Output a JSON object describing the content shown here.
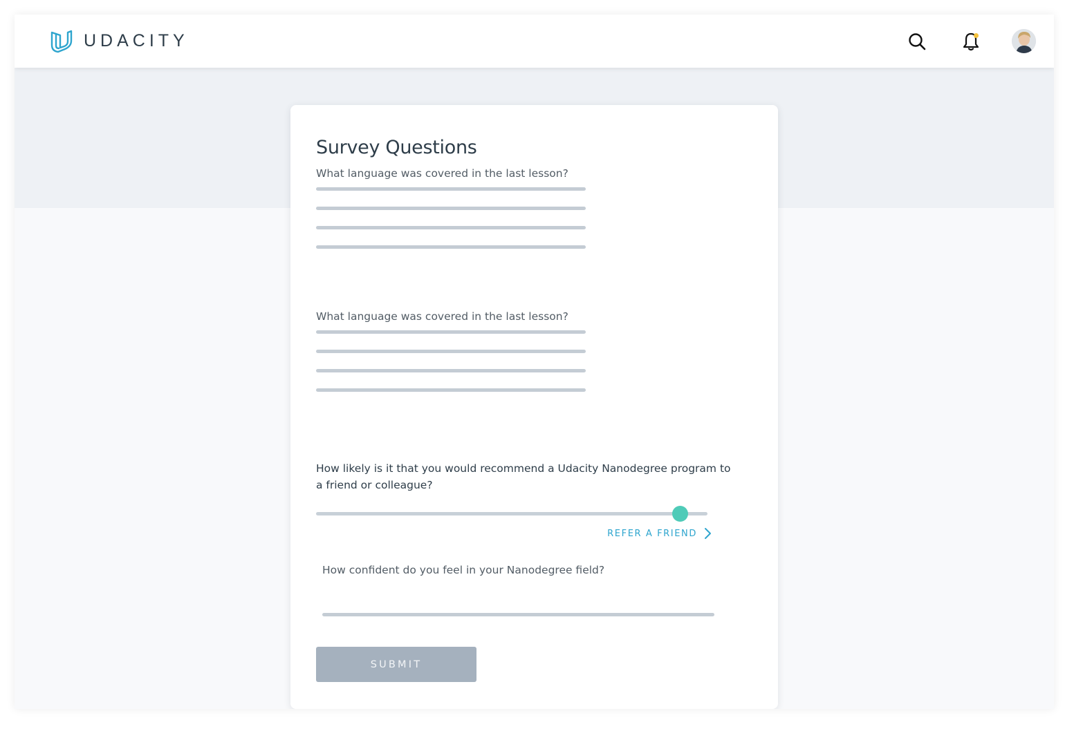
{
  "header": {
    "logo_text": "UDACITY",
    "icons": [
      "search-icon",
      "bell-icon",
      "avatar"
    ],
    "notification_dot_color": "#f5c23d",
    "brand_color": "#2ea5ce"
  },
  "survey": {
    "title": "Survey Questions",
    "question_1": {
      "label": "What language was covered in the last lesson?",
      "answer_lines": 4
    },
    "question_2": {
      "label": "What language was covered in the last lesson?",
      "answer_lines": 4
    },
    "nps": {
      "label": "How likely is it that you would recommend a Udacity Nanodegree program to a friend or colleague?",
      "slider_value_fraction": 0.93,
      "slider_color": "#4fcbb8"
    },
    "refer_link": "REFER A FRIEND",
    "confidence": {
      "label": "How confident do you feel in your Nanodegree field?",
      "value": ""
    },
    "submit_label": "SUBMIT",
    "submit_color": "#a5b1be"
  }
}
